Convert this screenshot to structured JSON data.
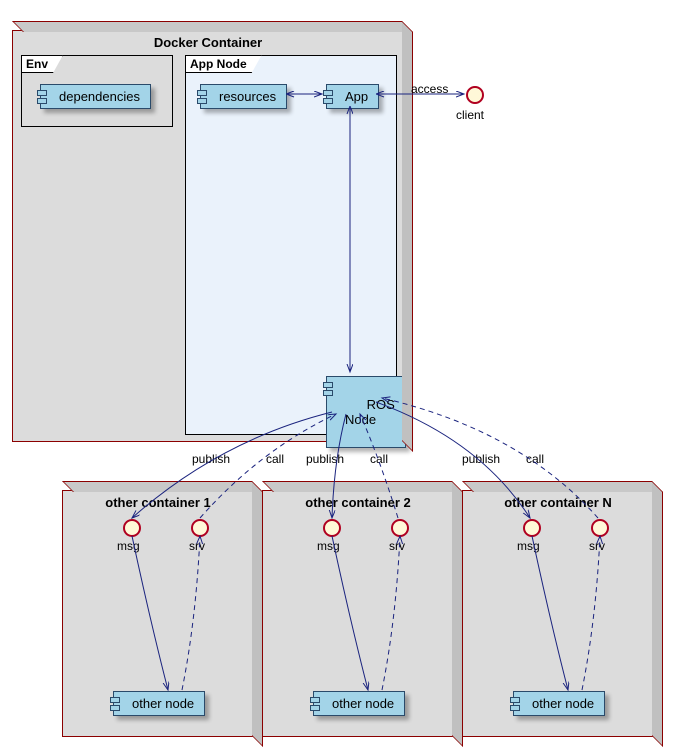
{
  "dockerContainer": {
    "title": "Docker Container",
    "env": {
      "tab": "Env",
      "dependencies": "dependencies"
    },
    "appNode": {
      "tab": "App Node",
      "resources": "resources",
      "app": "App",
      "rosNode": "ROS\nNode"
    }
  },
  "client": {
    "label": "client",
    "accessLabel": "access"
  },
  "otherContainers": [
    {
      "title": "other container 1",
      "msg": "msg",
      "srv": "srv",
      "node": "other node",
      "publish": "publish",
      "call": "call"
    },
    {
      "title": "other container 2",
      "msg": "msg",
      "srv": "srv",
      "node": "other node",
      "publish": "publish",
      "call": "call"
    },
    {
      "title": "other container N",
      "msg": "msg",
      "srv": "srv",
      "node": "other node",
      "publish": "publish",
      "call": "call"
    }
  ],
  "chart_data": {
    "type": "uml-deployment-diagram",
    "title": "Docker Container ROS Architecture",
    "nodes": [
      {
        "id": "docker",
        "type": "node",
        "label": "Docker Container",
        "children": [
          "env",
          "appnode"
        ]
      },
      {
        "id": "env",
        "type": "frame",
        "label": "Env",
        "children": [
          "dependencies"
        ]
      },
      {
        "id": "dependencies",
        "type": "component",
        "label": "dependencies"
      },
      {
        "id": "appnode",
        "type": "frame",
        "label": "App Node",
        "children": [
          "resources",
          "app",
          "rosnode"
        ]
      },
      {
        "id": "resources",
        "type": "component",
        "label": "resources"
      },
      {
        "id": "app",
        "type": "component",
        "label": "App"
      },
      {
        "id": "rosnode",
        "type": "component",
        "label": "ROS Node"
      },
      {
        "id": "client",
        "type": "interface",
        "label": "client"
      },
      {
        "id": "oc1",
        "type": "node",
        "label": "other container 1",
        "children": [
          "msg1",
          "srv1",
          "on1"
        ]
      },
      {
        "id": "msg1",
        "type": "interface",
        "label": "msg"
      },
      {
        "id": "srv1",
        "type": "interface",
        "label": "srv"
      },
      {
        "id": "on1",
        "type": "component",
        "label": "other node"
      },
      {
        "id": "oc2",
        "type": "node",
        "label": "other container 2",
        "children": [
          "msg2",
          "srv2",
          "on2"
        ]
      },
      {
        "id": "msg2",
        "type": "interface",
        "label": "msg"
      },
      {
        "id": "srv2",
        "type": "interface",
        "label": "srv"
      },
      {
        "id": "on2",
        "type": "component",
        "label": "other node"
      },
      {
        "id": "ocN",
        "type": "node",
        "label": "other container N",
        "children": [
          "msgN",
          "srvN",
          "onN"
        ]
      },
      {
        "id": "msgN",
        "type": "interface",
        "label": "msg"
      },
      {
        "id": "srvN",
        "type": "interface",
        "label": "srv"
      },
      {
        "id": "onN",
        "type": "component",
        "label": "other node"
      }
    ],
    "edges": [
      {
        "from": "app",
        "to": "client",
        "label": "access",
        "style": "solid",
        "direction": "both"
      },
      {
        "from": "resources",
        "to": "app",
        "style": "solid",
        "direction": "both"
      },
      {
        "from": "app",
        "to": "rosnode",
        "style": "solid",
        "direction": "both"
      },
      {
        "from": "rosnode",
        "to": "msg1",
        "label": "publish",
        "style": "solid",
        "direction": "to"
      },
      {
        "from": "srv1",
        "to": "rosnode",
        "label": "call",
        "style": "dashed",
        "direction": "to"
      },
      {
        "from": "msg1",
        "to": "on1",
        "style": "solid",
        "direction": "to"
      },
      {
        "from": "on1",
        "to": "srv1",
        "style": "dashed",
        "direction": "to"
      },
      {
        "from": "rosnode",
        "to": "msg2",
        "label": "publish",
        "style": "solid",
        "direction": "to"
      },
      {
        "from": "srv2",
        "to": "rosnode",
        "label": "call",
        "style": "dashed",
        "direction": "to"
      },
      {
        "from": "msg2",
        "to": "on2",
        "style": "solid",
        "direction": "to"
      },
      {
        "from": "on2",
        "to": "srv2",
        "style": "dashed",
        "direction": "to"
      },
      {
        "from": "rosnode",
        "to": "msgN",
        "label": "publish",
        "style": "solid",
        "direction": "to"
      },
      {
        "from": "srvN",
        "to": "rosnode",
        "label": "call",
        "style": "dashed",
        "direction": "to"
      },
      {
        "from": "msgN",
        "to": "onN",
        "style": "solid",
        "direction": "to"
      },
      {
        "from": "onN",
        "to": "srvN",
        "style": "dashed",
        "direction": "to"
      }
    ]
  }
}
